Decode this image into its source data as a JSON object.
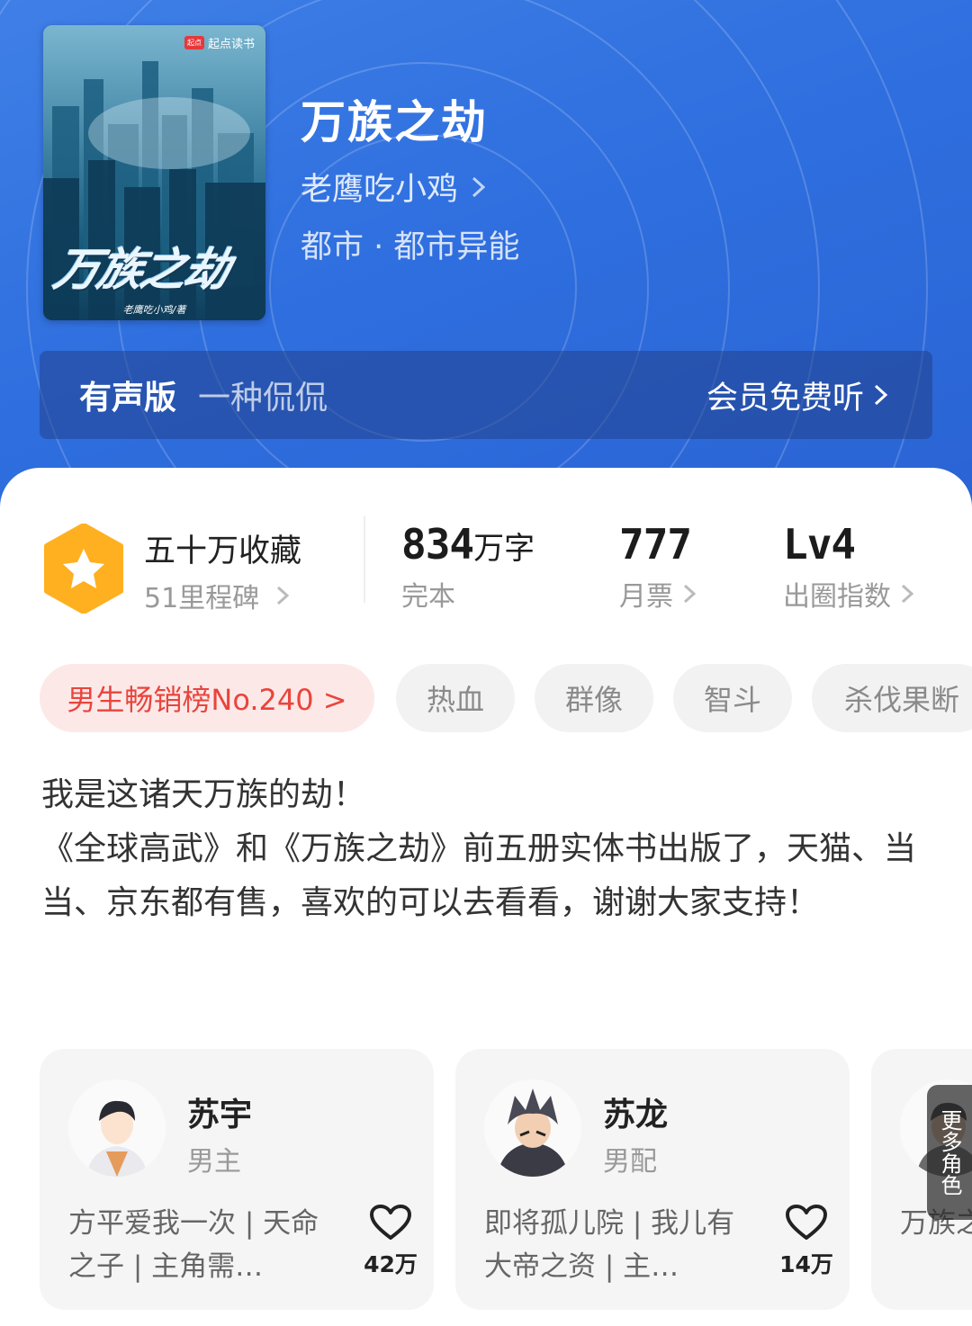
{
  "book": {
    "title": "万族之劫",
    "author": "老鹰吃小鸡",
    "genre": "都市 · 都市异能",
    "cover": {
      "brand": "起点读书",
      "brand_badge": "起点",
      "title": "万族之劫",
      "author_line": "老鹰吃小鸡/著"
    }
  },
  "audio": {
    "label": "有声版",
    "narrator": "一种侃侃",
    "cta": "会员免费听"
  },
  "stats": {
    "favorites": {
      "value": "五十万收藏",
      "sub": "51里程碑"
    },
    "words": {
      "value": "834",
      "unit": "万字",
      "label": "完本"
    },
    "monthly": {
      "value": "777",
      "label": "月票"
    },
    "circle": {
      "value": "Lv4",
      "label": "出圈指数"
    }
  },
  "tags": [
    {
      "label": "男生畅销榜No.240 >"
    },
    {
      "label": "热血"
    },
    {
      "label": "群像"
    },
    {
      "label": "智斗"
    },
    {
      "label": "杀伐果断"
    }
  ],
  "synopsis": "我是这诸天万族的劫！\n《全球高武》和《万族之劫》前五册实体书出版了，天猫、当当、京东都有售，喜欢的可以去看看，谢谢大家支持！",
  "characters": [
    {
      "name": "苏宇",
      "role": "男主",
      "desc": "方平爱我一次 | 天命之子 | 主角需…",
      "likes": "42万"
    },
    {
      "name": "苏龙",
      "role": "男配",
      "desc": "即将孤儿院 | 我儿有大帝之资 | 主…",
      "likes": "14万"
    },
    {
      "name": "",
      "role": "",
      "desc": "万族之…软饭硬…",
      "likes": ""
    }
  ],
  "more_roles": "更多角色",
  "colors": {
    "header_bg": "#2f6fdf",
    "rank_tag_text": "#e8453c",
    "rank_tag_bg": "#fde8e8",
    "badge": "#ffb020"
  }
}
